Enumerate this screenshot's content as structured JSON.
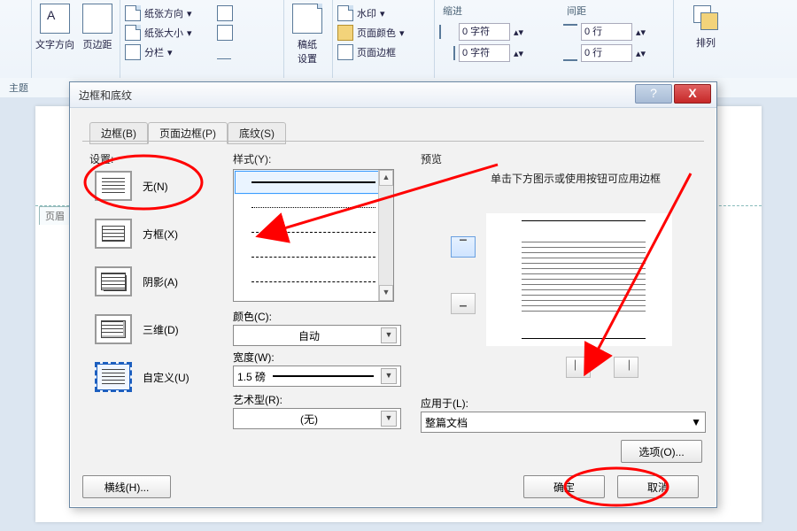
{
  "ribbon": {
    "theme_group_label": "主题",
    "text_direction": "文字方向",
    "margins": "页边距",
    "orientation": "纸张方向",
    "size": "纸张大小",
    "columns": "分栏",
    "blank_setting": "稿纸\n设置",
    "watermark": "水印",
    "page_color": "页面颜色",
    "page_border": "页面边框",
    "indent_header": "缩进",
    "spacing_header": "间距",
    "indent_left": "0 字符",
    "indent_right": "0 字符",
    "spacing_before": "0 行",
    "spacing_after": "0 行",
    "arrange": "排列"
  },
  "doc": {
    "header_marker": "页眉"
  },
  "dialog": {
    "title": "边框和底纹",
    "help": "?",
    "close": "X",
    "tabs": {
      "borders": "边框(B)",
      "page_borders": "页面边框(P)",
      "shading": "底纹(S)"
    },
    "settings_label": "设置:",
    "styles_label": "样式(Y):",
    "preview_label": "预览",
    "options": {
      "none": "无(N)",
      "box": "方框(X)",
      "shadow": "阴影(A)",
      "three_d": "三维(D)",
      "custom": "自定义(U)"
    },
    "color_label": "颜色(C):",
    "color_value": "自动",
    "width_label": "宽度(W):",
    "width_value": "1.5 磅",
    "art_label": "艺术型(R):",
    "art_value": "(无)",
    "preview_hint": "单击下方图示或使用按钮可应用边框",
    "apply_label": "应用于(L):",
    "apply_value": "整篇文档",
    "options_btn": "选项(O)...",
    "hline_btn": "横线(H)...",
    "ok": "确定",
    "cancel": "取消"
  }
}
